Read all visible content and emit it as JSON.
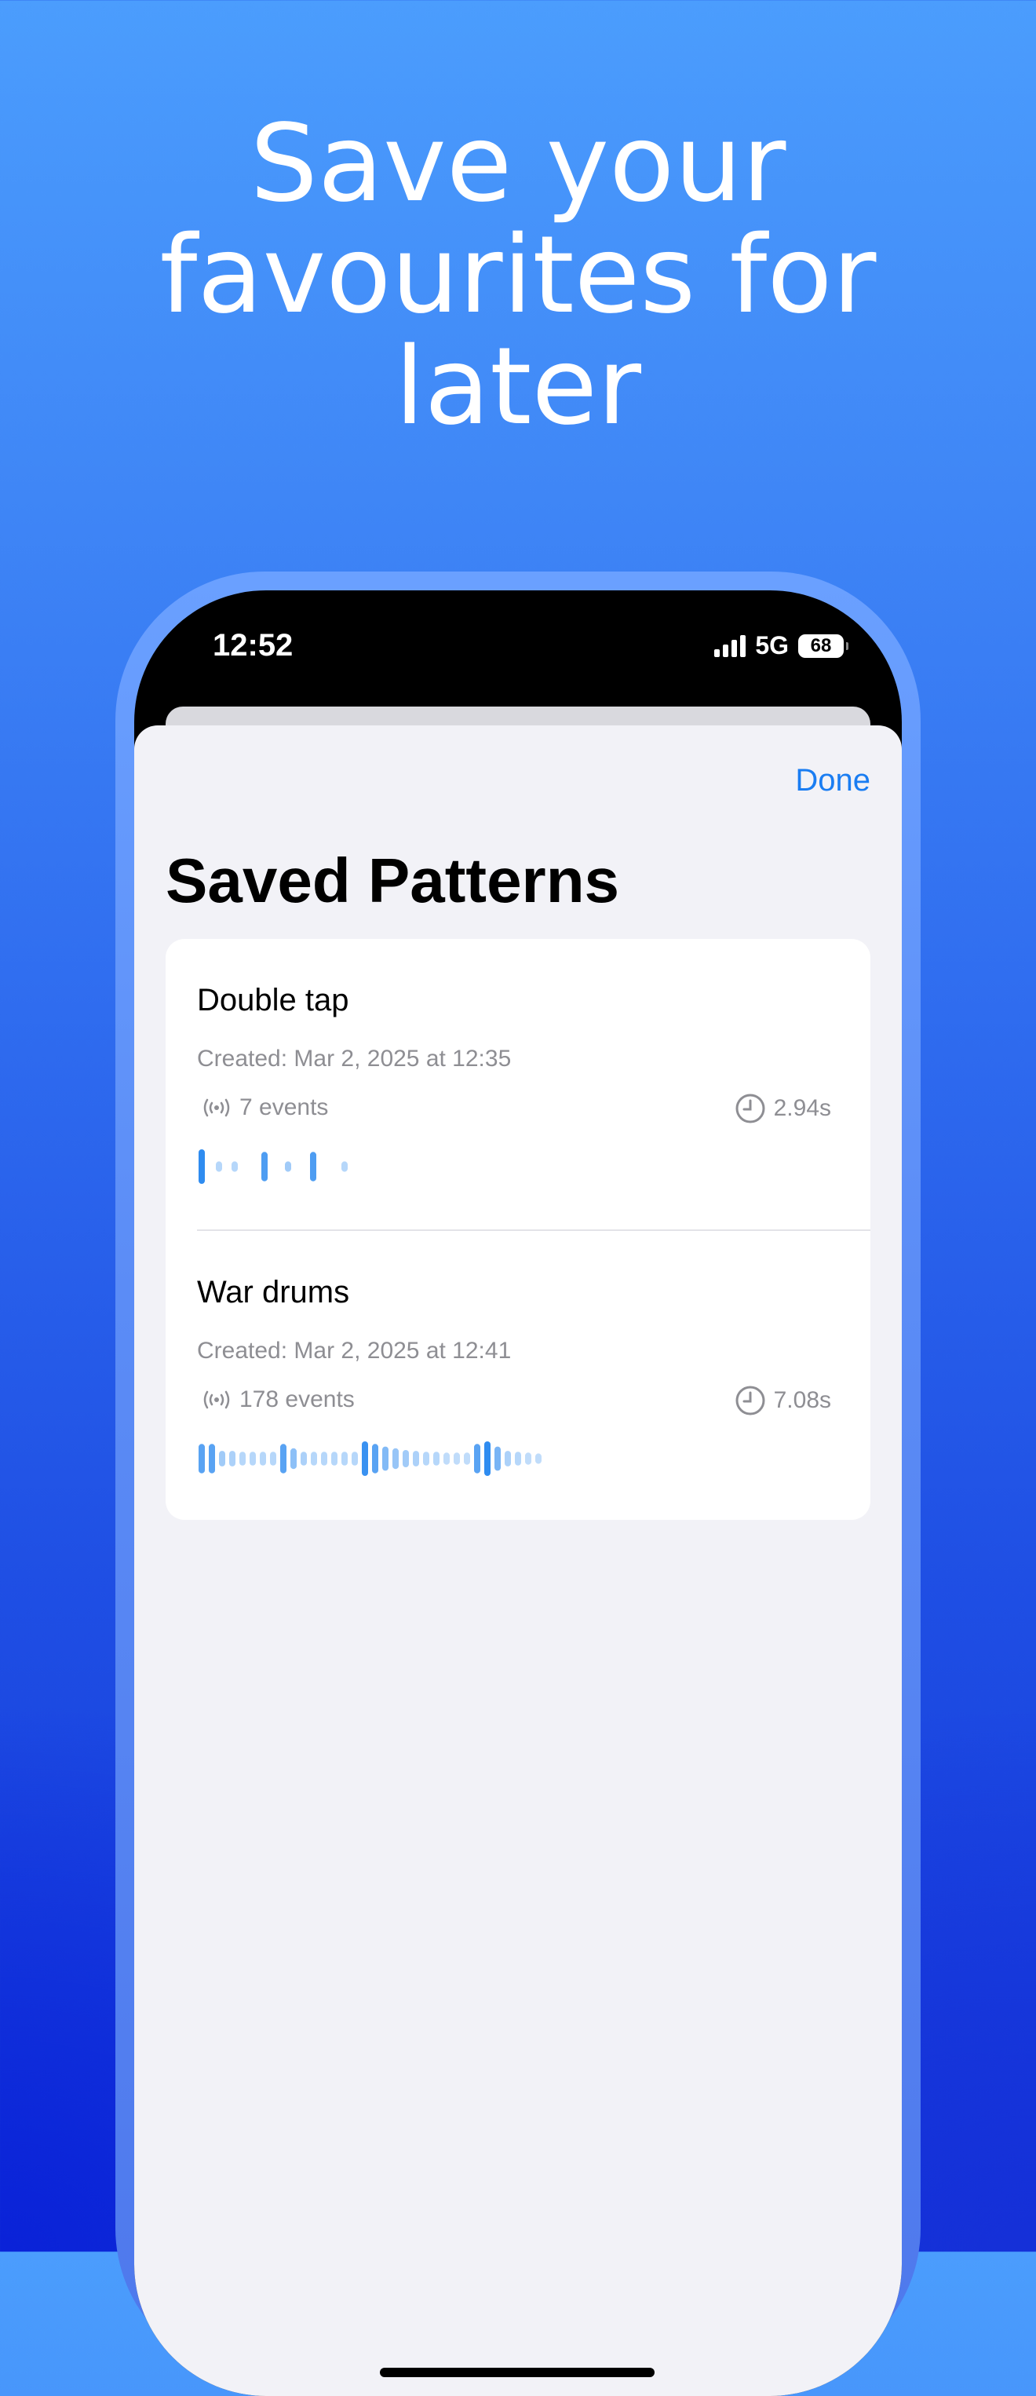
{
  "headline": {
    "line1": "Save your",
    "line2": "favourites for",
    "line3": "later"
  },
  "status_bar": {
    "time": "12:52",
    "network": "5G",
    "battery": "68"
  },
  "sheet": {
    "done_label": "Done",
    "title": "Saved Patterns"
  },
  "patterns": [
    {
      "name": "Double tap",
      "created": "Created: Mar 2, 2025 at 12:35",
      "events": "7 events",
      "duration": "2.94s",
      "wave": [
        {
          "h": 1.0,
          "i": 1.0
        },
        {
          "h": 0.3,
          "i": 0.35
        },
        {
          "h": 0.3,
          "i": 0.35
        },
        {
          "h": 0.85,
          "i": 0.85
        },
        {
          "h": 0.3,
          "i": 0.45
        },
        {
          "h": 0.85,
          "i": 0.85
        },
        {
          "h": 0.3,
          "i": 0.35
        }
      ]
    },
    {
      "name": "War drums",
      "created": "Created: Mar 2, 2025 at 12:41",
      "events": "178 events",
      "duration": "7.08s",
      "wave": [
        {
          "h": 0.85,
          "i": 0.8
        },
        {
          "h": 0.85,
          "i": 0.8
        },
        {
          "h": 0.45,
          "i": 0.45
        },
        {
          "h": 0.45,
          "i": 0.4
        },
        {
          "h": 0.4,
          "i": 0.35
        },
        {
          "h": 0.4,
          "i": 0.35
        },
        {
          "h": 0.4,
          "i": 0.35
        },
        {
          "h": 0.4,
          "i": 0.35
        },
        {
          "h": 0.85,
          "i": 0.8
        },
        {
          "h": 0.6,
          "i": 0.55
        },
        {
          "h": 0.4,
          "i": 0.4
        },
        {
          "h": 0.4,
          "i": 0.35
        },
        {
          "h": 0.4,
          "i": 0.35
        },
        {
          "h": 0.4,
          "i": 0.35
        },
        {
          "h": 0.4,
          "i": 0.35
        },
        {
          "h": 0.4,
          "i": 0.35
        },
        {
          "h": 1.0,
          "i": 0.95
        },
        {
          "h": 0.85,
          "i": 0.8
        },
        {
          "h": 0.7,
          "i": 0.6
        },
        {
          "h": 0.6,
          "i": 0.5
        },
        {
          "h": 0.5,
          "i": 0.45
        },
        {
          "h": 0.45,
          "i": 0.4
        },
        {
          "h": 0.4,
          "i": 0.35
        },
        {
          "h": 0.4,
          "i": 0.35
        },
        {
          "h": 0.35,
          "i": 0.3
        },
        {
          "h": 0.35,
          "i": 0.3
        },
        {
          "h": 0.35,
          "i": 0.3
        },
        {
          "h": 0.85,
          "i": 0.8
        },
        {
          "h": 1.0,
          "i": 1.0
        },
        {
          "h": 0.7,
          "i": 0.65
        },
        {
          "h": 0.45,
          "i": 0.4
        },
        {
          "h": 0.4,
          "i": 0.35
        },
        {
          "h": 0.35,
          "i": 0.3
        },
        {
          "h": 0.3,
          "i": 0.3
        }
      ]
    }
  ],
  "colors": {
    "accent": "#1a7df2",
    "wave": "#2f8cf0",
    "secondary_text": "#8e8e93"
  }
}
